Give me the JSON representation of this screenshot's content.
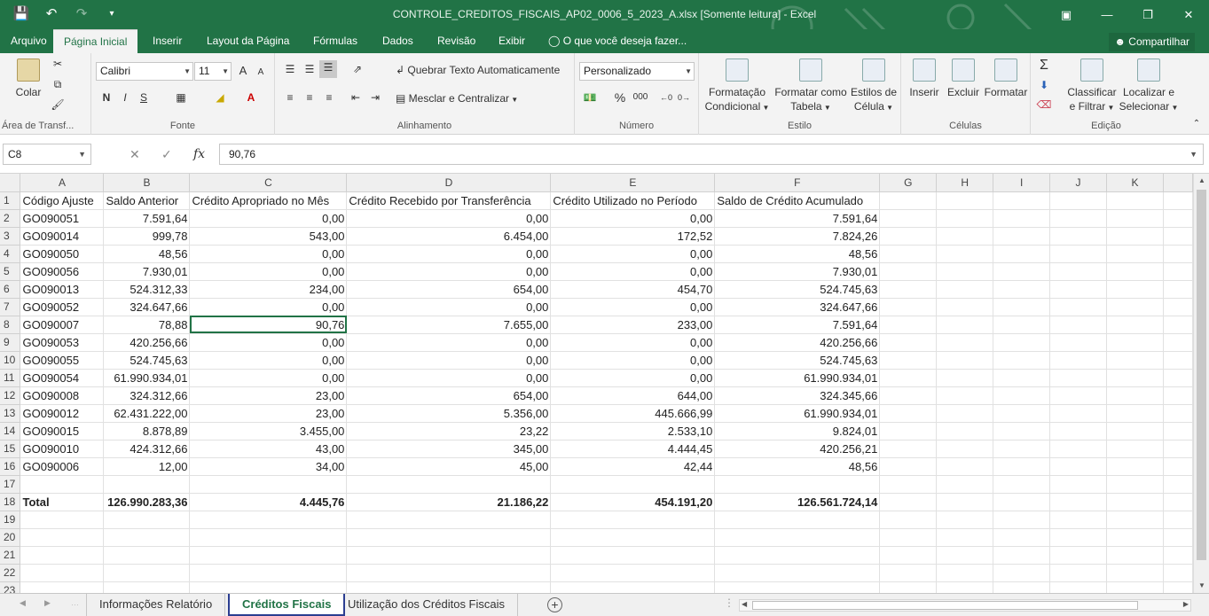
{
  "titlebar": {
    "title": "CONTROLE_CREDITOS_FISCAIS_AP02_0006_5_2023_A.xlsx  [Somente leitura] - Excel",
    "save_icon": "save-icon",
    "undo_icon": "undo-icon",
    "redo_icon": "redo-icon"
  },
  "menu": {
    "tabs": [
      "Arquivo",
      "Página Inicial",
      "Inserir",
      "Layout da Página",
      "Fórmulas",
      "Dados",
      "Revisão",
      "Exibir"
    ],
    "active_tab": "Página Inicial",
    "tell_me": "O que você deseja fazer...",
    "share": "Compartilhar"
  },
  "ribbon": {
    "clipboard": {
      "paste": "Colar",
      "label": "Área de Transf..."
    },
    "font": {
      "name": "Calibri",
      "size": "11",
      "bold": "N",
      "italic": "I",
      "underline": "S",
      "grow": "A",
      "shrink": "A",
      "label": "Fonte"
    },
    "alignment": {
      "wrap": "Quebrar Texto Automaticamente",
      "merge": "Mesclar e Centralizar",
      "label": "Alinhamento"
    },
    "number": {
      "format": "Personalizado",
      "percent": "%",
      "thousands": "000",
      "label": "Número"
    },
    "styles": {
      "conditional_1": "Formatação",
      "conditional_2": "Condicional",
      "table_1": "Formatar como",
      "table_2": "Tabela",
      "cell_1": "Estilos de",
      "cell_2": "Célula",
      "label": "Estilo"
    },
    "cells": {
      "insert": "Inserir",
      "delete": "Excluir",
      "format": "Formatar",
      "label": "Células"
    },
    "editing": {
      "sort_1": "Classificar",
      "sort_2": "e Filtrar",
      "find_1": "Localizar e",
      "find_2": "Selecionar",
      "label": "Edição"
    }
  },
  "formula_bar": {
    "name_box": "C8",
    "fx": "fx",
    "value": "90,76"
  },
  "sheet": {
    "columns": [
      "A",
      "B",
      "C",
      "D",
      "E",
      "F",
      "G",
      "H",
      "I",
      "J",
      "K"
    ],
    "headers": [
      "Código Ajuste",
      "Saldo Anterior",
      "Crédito Apropriado no Mês",
      "Crédito Recebido por Transferência",
      "Crédito Utilizado no Período",
      "Saldo de Crédito Acumulado"
    ],
    "rows": [
      [
        "GO090051",
        "7.591,64",
        "0,00",
        "0,00",
        "0,00",
        "7.591,64"
      ],
      [
        "GO090014",
        "999,78",
        "543,00",
        "6.454,00",
        "172,52",
        "7.824,26"
      ],
      [
        "GO090050",
        "48,56",
        "0,00",
        "0,00",
        "0,00",
        "48,56"
      ],
      [
        "GO090056",
        "7.930,01",
        "0,00",
        "0,00",
        "0,00",
        "7.930,01"
      ],
      [
        "GO090013",
        "524.312,33",
        "234,00",
        "654,00",
        "454,70",
        "524.745,63"
      ],
      [
        "GO090052",
        "324.647,66",
        "0,00",
        "0,00",
        "0,00",
        "324.647,66"
      ],
      [
        "GO090007",
        "78,88",
        "90,76",
        "7.655,00",
        "233,00",
        "7.591,64"
      ],
      [
        "GO090053",
        "420.256,66",
        "0,00",
        "0,00",
        "0,00",
        "420.256,66"
      ],
      [
        "GO090055",
        "524.745,63",
        "0,00",
        "0,00",
        "0,00",
        "524.745,63"
      ],
      [
        "GO090054",
        "61.990.934,01",
        "0,00",
        "0,00",
        "0,00",
        "61.990.934,01"
      ],
      [
        "GO090008",
        "324.312,66",
        "23,00",
        "654,00",
        "644,00",
        "324.345,66"
      ],
      [
        "GO090012",
        "62.431.222,00",
        "23,00",
        "5.356,00",
        "445.666,99",
        "61.990.934,01"
      ],
      [
        "GO090015",
        "8.878,89",
        "3.455,00",
        "23,22",
        "2.533,10",
        "9.824,01"
      ],
      [
        "GO090010",
        "424.312,66",
        "43,00",
        "345,00",
        "4.444,45",
        "420.256,21"
      ],
      [
        "GO090006",
        "12,00",
        "34,00",
        "45,00",
        "42,44",
        "48,56"
      ]
    ],
    "total": [
      "Total",
      "126.990.283,36",
      "4.445,76",
      "21.186,22",
      "454.191,20",
      "126.561.724,14"
    ],
    "row_numbers": [
      "1",
      "2",
      "3",
      "4",
      "5",
      "6",
      "7",
      "8",
      "9",
      "10",
      "11",
      "12",
      "13",
      "14",
      "15",
      "16",
      "17",
      "18",
      "19",
      "20",
      "21",
      "22",
      "23"
    ],
    "selected_cell": "C8"
  },
  "sheet_tabs": [
    "Informações Relatório",
    "Créditos Fiscais",
    "Utilização dos Créditos Fiscais"
  ],
  "active_sheet": "Créditos Fiscais",
  "colors": {
    "excel_green": "#217346",
    "active_tab_border": "#2b3e91"
  }
}
